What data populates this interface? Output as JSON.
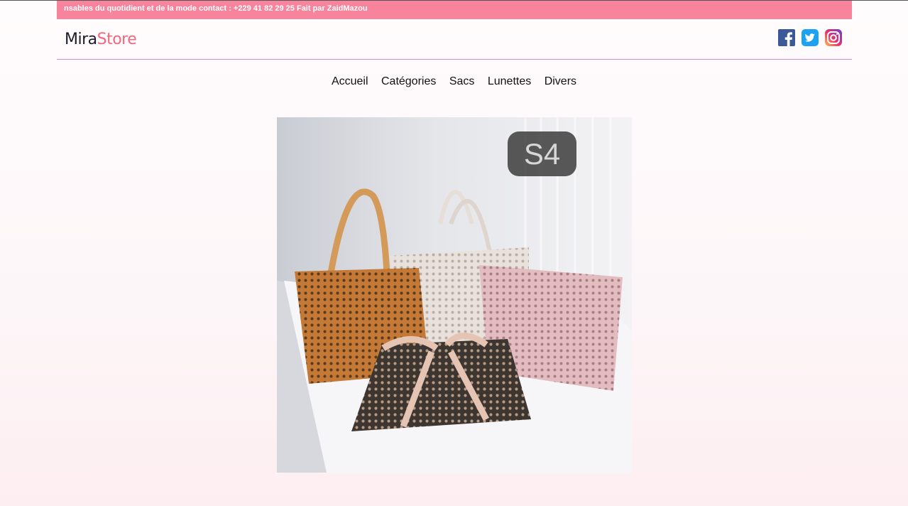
{
  "ticker": {
    "text": "nsables du quotidient et de la mode contact : +229 41 82 29 25 Fait par ZaidMazou"
  },
  "logo": {
    "part1": "Mira",
    "part2": "Store"
  },
  "social": {
    "icons": [
      "facebook-icon",
      "twitter-icon",
      "instagram-icon"
    ]
  },
  "nav": {
    "items": [
      "Accueil",
      "Catégories",
      "Sacs",
      "Lunettes",
      "Divers"
    ]
  },
  "hero": {
    "badge": "S4",
    "icon": "tote-bags-photo"
  },
  "colors": {
    "ticker_bg": "#f7839c",
    "logo_accent": "#f0697d",
    "divider": "#c98fc8",
    "facebook": "#3b5998",
    "twitter": "#1da1f2"
  }
}
